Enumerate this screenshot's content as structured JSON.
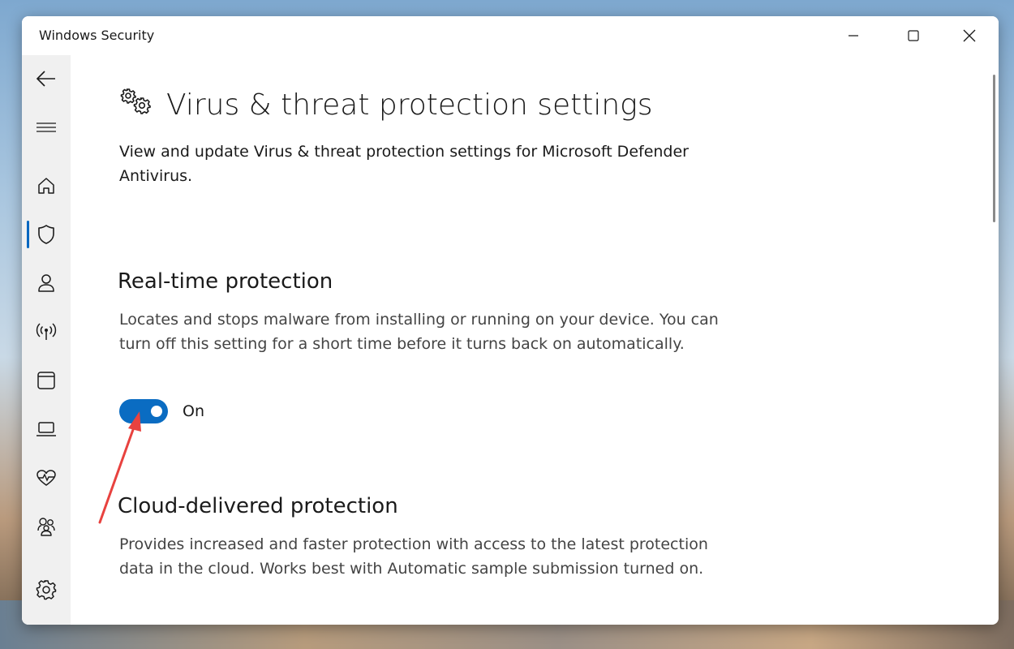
{
  "window": {
    "title": "Windows Security"
  },
  "sidebar": {
    "items": [
      {
        "icon": "back-arrow-icon"
      },
      {
        "icon": "hamburger-menu-icon"
      },
      {
        "icon": "home-icon"
      },
      {
        "icon": "shield-icon",
        "active": true
      },
      {
        "icon": "account-icon"
      },
      {
        "icon": "wireless-icon"
      },
      {
        "icon": "app-browser-icon"
      },
      {
        "icon": "laptop-icon"
      },
      {
        "icon": "heartbeat-icon"
      },
      {
        "icon": "family-icon"
      },
      {
        "icon": "gear-icon"
      }
    ]
  },
  "page": {
    "title": "Virus & threat protection settings",
    "description": "View and update Virus & threat protection settings for Microsoft Defender Antivirus."
  },
  "sections": [
    {
      "title": "Real-time protection",
      "description": "Locates and stops malware from installing or running on your device. You can turn off this setting for a short time before it turns back on automatically.",
      "toggle_state": "On"
    },
    {
      "title": "Cloud-delivered protection",
      "description": "Provides increased and faster protection with access to the latest protection data in the cloud. Works best with Automatic sample submission turned on."
    }
  ],
  "colors": {
    "accent": "#0a6cc2",
    "annotation": "#e8423f"
  }
}
